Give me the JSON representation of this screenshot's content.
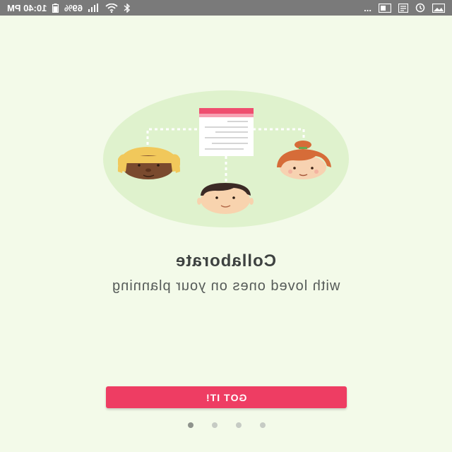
{
  "status_bar": {
    "time": "10:40 PM",
    "battery_percent": "69%",
    "overflow": "...",
    "icons": [
      "battery-icon",
      "signal-icon",
      "wifi-icon",
      "bluetooth-icon",
      "gallery-icon",
      "news-icon",
      "sync-icon",
      "image-icon"
    ]
  },
  "onboarding": {
    "title": "Collaborate",
    "subtitle": "with loved ones on your planning",
    "button_label": "GOT IT!",
    "page_indicator": {
      "total": 4,
      "active_index": 0
    }
  },
  "colors": {
    "background": "#f3fae9",
    "accent": "#ee3d63",
    "circle": "#dff2cd",
    "status_bar": "#7a7a7a"
  }
}
